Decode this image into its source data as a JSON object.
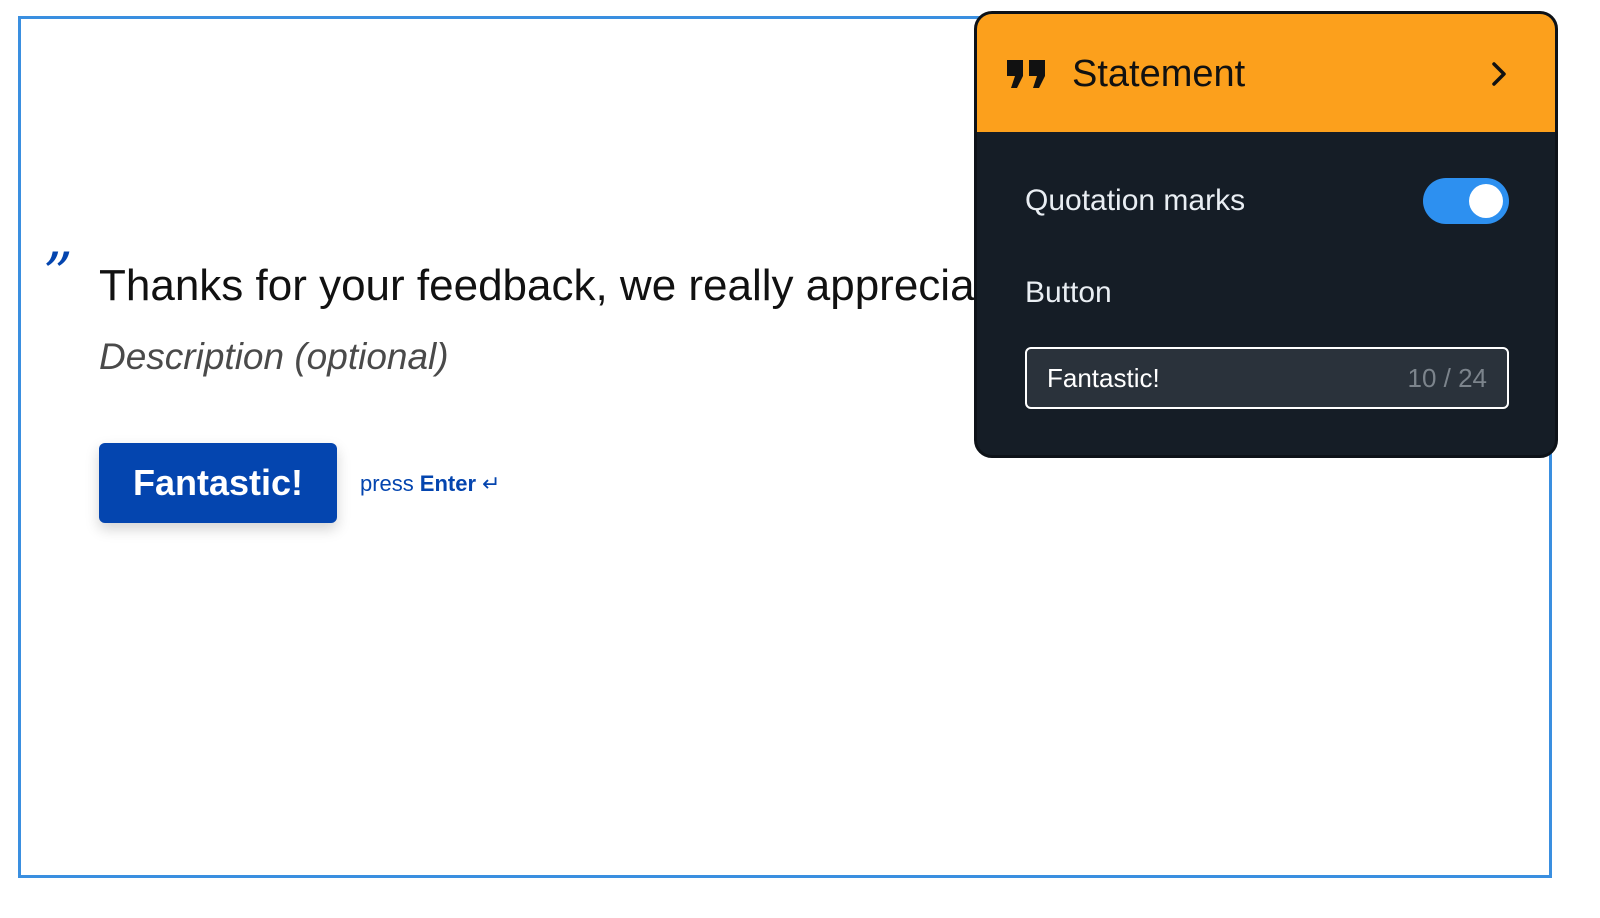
{
  "statement": {
    "quote_mark": "”",
    "title": "Thanks for your feedback, we really appreciate it!",
    "description_placeholder": "Description (optional)",
    "button_label": "Fantastic!",
    "hint_prefix": "press",
    "hint_key": "Enter",
    "hint_icon": "↵"
  },
  "panel": {
    "header_icon": "quote-icon",
    "header_title": "Statement",
    "header_chevron": "chevron-right-icon",
    "quotation_marks_label": "Quotation marks",
    "quotation_marks_enabled": true,
    "button_section_label": "Button",
    "button_field_value": "Fantastic!",
    "button_field_counter": "10 / 24"
  },
  "colors": {
    "brand_blue": "#0445af",
    "canvas_border": "#3a8fe0",
    "panel_header": "#fca01c",
    "panel_bg": "#151d26",
    "toggle_on": "#2d90f0"
  }
}
